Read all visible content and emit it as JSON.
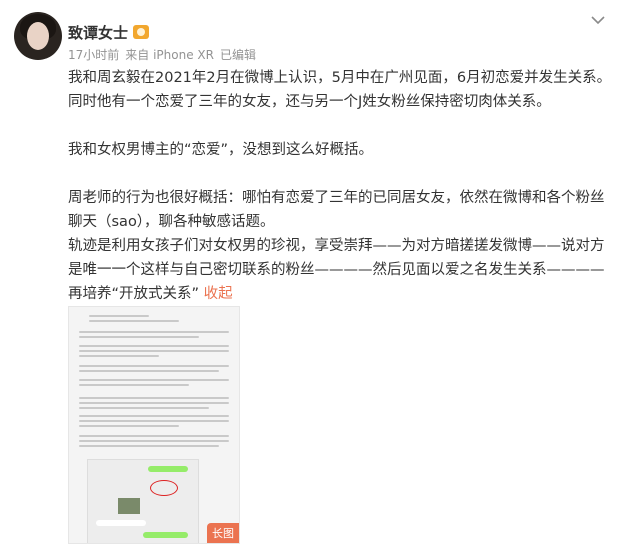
{
  "post": {
    "author": "致谭女士",
    "time": "17小时前",
    "source": "来自 iPhone XR",
    "edited": "已编辑",
    "paragraphs": [
      "我和周玄毅在2021年2月在微博上认识，5月中在广州见面，6月初恋爱并发生关系。同时他有一个恋爱了三年的女友，还与另一个J姓女粉丝保持密切肉体关系。",
      "我和女权男博主的“恋爱”，没想到这么好概括。",
      "周老师的行为也很好概括：哪怕有恋爱了三年的已同居女友，依然在微博和各个粉丝聊天（sao），聊各种敏感话题。",
      "轨迹是利用女孩子们对女权男的珍视，享受崇拜——为对方暗搓搓发微博——说对方是唯一一个这样与自己密切联系的粉丝————然后见面以爱之名发生关系————再培养“开放式关系”"
    ],
    "collapse_label": "收起",
    "image_badge": "长图"
  },
  "icons": {
    "vip": "vip-badge-icon",
    "more": "chevron-down-icon"
  },
  "colors": {
    "accent": "#eb7350",
    "meta_text": "#939393",
    "body_text": "#333333"
  }
}
